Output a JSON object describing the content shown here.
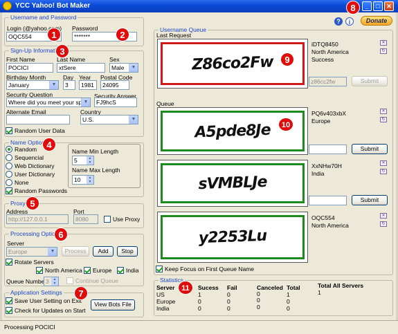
{
  "window": {
    "title": "YCC Yahoo! Bot Maker"
  },
  "account": {
    "group_title": "Username and Password",
    "login_label": "Login (@yahoo.com)",
    "login_value": "OQC554",
    "password_label": "Password",
    "password_value": "*******"
  },
  "signup": {
    "group_title": "Sign-Up Information",
    "first_name_label": "First Name",
    "first_name": "POCICI",
    "last_name_label": "Last Name",
    "last_name": "xtSere",
    "sex_label": "Sex",
    "sex": "Male",
    "month_label": "Birthday Month",
    "month": "January",
    "day_label": "Day",
    "day": "3",
    "year_label": "Year",
    "year": "1981",
    "postal_label": "Postal Code",
    "postal": "24095",
    "question_label": "Security Question",
    "question": "Where did you meet your spous",
    "answer_label": "Security Answer",
    "answer": "FJ9hcS",
    "alt_email_label": "Alternate Email",
    "alt_email": "",
    "country_label": "Country",
    "country": "U.S.",
    "random_user_data": "Random User Data"
  },
  "name_options": {
    "group_title": "Name Options",
    "radios": [
      "Random",
      "Sequencial",
      "Web Dictionary",
      "User Dictionary",
      "None"
    ],
    "selected": "Random",
    "random_passwords": "Random Passwords",
    "min_label": "Name Min Length",
    "min_value": "5",
    "max_label": "Name Max Length",
    "max_value": "10"
  },
  "proxy": {
    "group_title": "Proxy",
    "address_label": "Address",
    "address": "http://127.0.0.1",
    "port_label": "Port",
    "port": "8080",
    "use_proxy": "Use Proxy"
  },
  "processing": {
    "group_title": "Processing Options",
    "server_label": "Server",
    "server": "Europe",
    "process_btn": "Process",
    "add_btn": "Add",
    "stop_btn": "Stop",
    "rotate": "Rotate Servers",
    "north_america": "North America",
    "europe": "Europe",
    "india": "India",
    "queue_number_label": "Queue Number",
    "queue_number": "3",
    "continue_queue": "Continue Queue"
  },
  "app_settings": {
    "group_title": "Application Settings",
    "save_settings": "Save User Setting on Exit",
    "check_updates": "Check for Updates on Start",
    "view_bots": "View Bots File"
  },
  "username_queue": {
    "group_title": "Username Queue",
    "last_request_label": "Last Request",
    "last_request": {
      "captcha": "Z86co2Fw",
      "user": "iDTQ8450",
      "region": "North America",
      "status": "Success",
      "answer": "z86cc2fw"
    },
    "queue_label": "Queue",
    "items": [
      {
        "captcha": "A5pde8Je",
        "user": "PQ6v403xbX",
        "region": "Europe",
        "answer": ""
      },
      {
        "captcha": "sVMBLJe",
        "user": "XxNHw70H",
        "region": "India",
        "answer": ""
      },
      {
        "captcha": "y2253Lu",
        "user": "OQC554",
        "region": "North America",
        "answer": ""
      }
    ],
    "submit": "Submit",
    "keep_focus": "Keep Focus on First Queue Name"
  },
  "statistics": {
    "group_title": "Statistics",
    "headers": [
      "Server",
      "Sucess",
      "Fail",
      "Canceled",
      "Total"
    ],
    "rows": [
      [
        "US",
        "1",
        "0",
        "0",
        "1"
      ],
      [
        "Europe",
        "0",
        "0",
        "0",
        "0"
      ],
      [
        "India",
        "0",
        "0",
        "0",
        "0"
      ]
    ],
    "total_all_label": "Total All Servers",
    "total_all_value": "1"
  },
  "donate_label": "Donate",
  "badges": [
    "1",
    "2",
    "3",
    "4",
    "5",
    "6",
    "7",
    "8",
    "9",
    "10",
    "11"
  ],
  "status_text": "Processing POCICI",
  "colors": {
    "titlebar": "#0b4ad6",
    "group_title": "#1c45c9",
    "badge": "#e00b0b",
    "captcha_ok": "#1c8a1c",
    "captcha_last": "#d01818"
  }
}
